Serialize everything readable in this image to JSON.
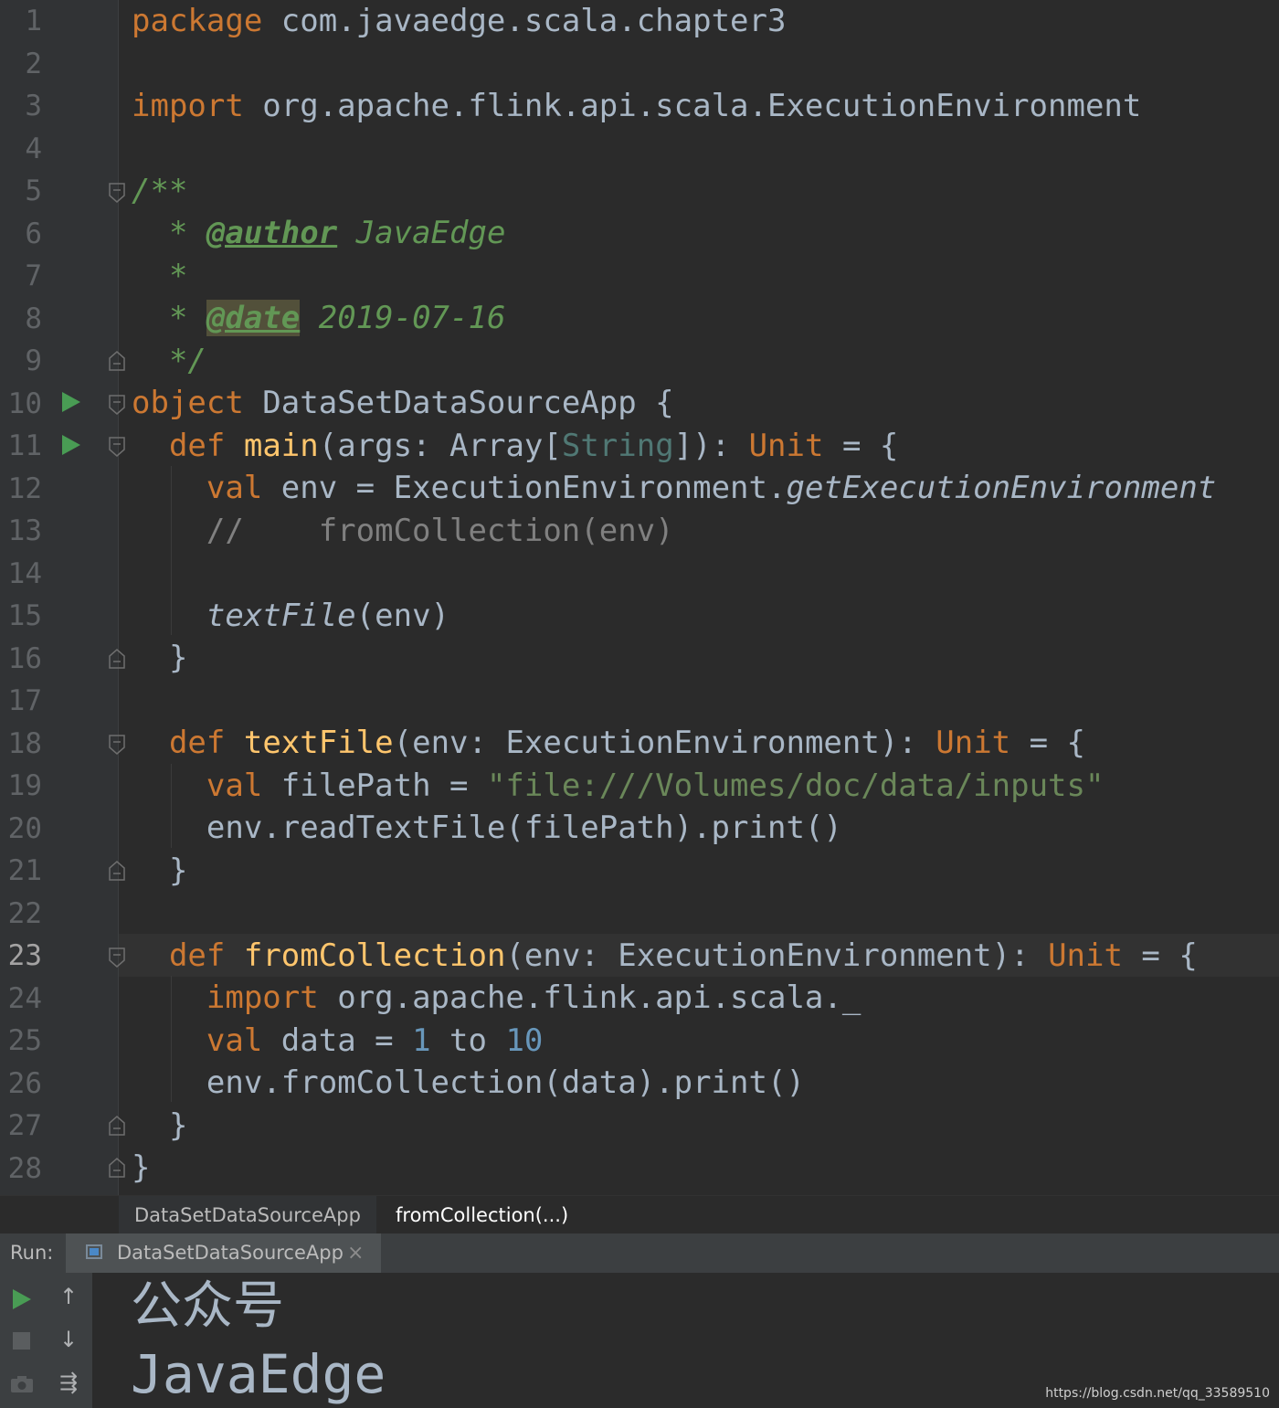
{
  "code": {
    "line_numbers": [
      "1",
      "2",
      "3",
      "4",
      "5",
      "6",
      "7",
      "8",
      "9",
      "10",
      "11",
      "12",
      "13",
      "14",
      "15",
      "16",
      "17",
      "18",
      "19",
      "20",
      "21",
      "22",
      "23",
      "24",
      "25",
      "26",
      "27",
      "28"
    ],
    "current_line": "23",
    "l1": {
      "kw": "package",
      "rest": " com.javaedge.scala.chapter3"
    },
    "l3": {
      "kw": "import",
      "rest": " org.apache.flink.api.scala.ExecutionEnvironment"
    },
    "l5": {
      "doc": "/**"
    },
    "l6": {
      "star": "  * ",
      "tag": "@author",
      "text": " JavaEdge"
    },
    "l7": {
      "star": "  *"
    },
    "l8": {
      "star": "  * ",
      "tag": "@date",
      "text": " 2019-07-16"
    },
    "l9": {
      "doc": "  */"
    },
    "l10": {
      "kw": "object",
      "rest": " DataSetDataSourceApp {"
    },
    "l11": {
      "indent": "  ",
      "kw": "def",
      "fn": "main",
      "p1": "(args: Array[",
      "tparam": "String",
      "p2": "]): ",
      "type": "Unit",
      "p3": " = {"
    },
    "l12": {
      "indent": "    ",
      "kw": "val",
      "p1": " env = ExecutionEnvironment.",
      "ital": "getExecutionEnvironment"
    },
    "l13": {
      "cmt": "    //    fromCollection(env)"
    },
    "l15": {
      "indent": "    ",
      "ital": "textFile",
      "p1": "(env)"
    },
    "l16": {
      "text": "  }"
    },
    "l18": {
      "indent": "  ",
      "kw": "def",
      "fn": "textFile",
      "p1": "(env: ExecutionEnvironment): ",
      "type": "Unit",
      "p2": " = {"
    },
    "l19": {
      "indent": "    ",
      "kw": "val",
      "p1": " filePath = ",
      "str": "\"file:///Volumes/doc/data/inputs\""
    },
    "l20": {
      "text": "    env.readTextFile(filePath).print()"
    },
    "l21": {
      "text": "  }"
    },
    "l23": {
      "indent": "  ",
      "kw": "def",
      "fn": "fromCollection",
      "p1": "(env: ExecutionEnvironment): ",
      "type": "Unit",
      "p2": " = {"
    },
    "l24": {
      "indent": "    ",
      "kw": "import",
      "rest": " org.apache.flink.api.scala._"
    },
    "l25": {
      "indent": "    ",
      "kw": "val",
      "p1": " data = ",
      "n1": "1",
      "p2": " to ",
      "n2": "10"
    },
    "l26": {
      "text": "    env.fromCollection(data).print()"
    },
    "l27": {
      "text": "  }"
    },
    "l28": {
      "text": "}"
    }
  },
  "breadcrumbs": {
    "item1": "DataSetDataSourceApp",
    "item2": "fromCollection(...)"
  },
  "run_panel": {
    "label": "Run:",
    "tab_label": "DataSetDataSourceApp",
    "close_glyph": "×"
  },
  "console": {
    "line1": "公众号",
    "line2": "JavaEdge"
  },
  "toolbar": {
    "up_glyph": "↑",
    "down_glyph": "↓",
    "wrap_glyph": "⇶"
  },
  "watermark": "https://blog.csdn.net/qq_33589510",
  "colors": {
    "background": "#2b2b2b",
    "keyword": "#cc7832",
    "function": "#ffc66d",
    "doc": "#629755",
    "string": "#6a8759",
    "number": "#6897bb",
    "run_green": "#499c54"
  }
}
